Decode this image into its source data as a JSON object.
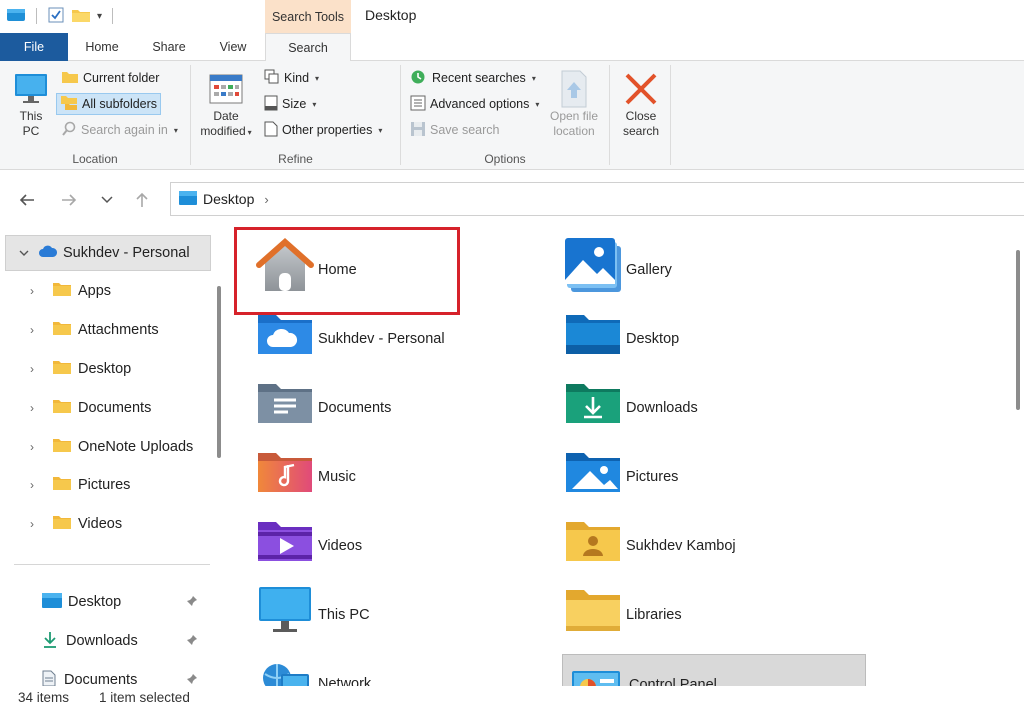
{
  "window": {
    "context_tab_header": "Search Tools",
    "title": "Desktop"
  },
  "ribbon_tabs": {
    "file": "File",
    "home": "Home",
    "share": "Share",
    "view": "View",
    "search": "Search"
  },
  "ribbon": {
    "location": {
      "label": "Location",
      "this_pc_line1": "This",
      "this_pc_line2": "PC",
      "current_folder": "Current folder",
      "all_subfolders": "All subfolders",
      "search_again_in": "Search again in"
    },
    "refine": {
      "label": "Refine",
      "date_modified_line1": "Date",
      "date_modified_line2": "modified",
      "kind": "Kind",
      "size": "Size",
      "other_properties": "Other properties"
    },
    "options": {
      "label": "Options",
      "recent_searches": "Recent searches",
      "advanced_options": "Advanced options",
      "save_search": "Save search",
      "open_file_location_line1": "Open file",
      "open_file_location_line2": "location"
    },
    "close": {
      "line1": "Close",
      "line2": "search"
    }
  },
  "address": {
    "path": "Desktop"
  },
  "navpane": {
    "root": "Sukhdev - Personal",
    "children": [
      "Apps",
      "Attachments",
      "Desktop",
      "Documents",
      "OneNote Uploads",
      "Pictures",
      "Videos"
    ],
    "quick_access": [
      "Desktop",
      "Downloads",
      "Documents"
    ]
  },
  "content": {
    "items": [
      {
        "name": "Home",
        "icon": "home-icon"
      },
      {
        "name": "Gallery",
        "icon": "gallery-icon"
      },
      {
        "name": "Sukhdev - Personal",
        "icon": "onedrive-folder-icon"
      },
      {
        "name": "Desktop",
        "icon": "desktop-folder-icon"
      },
      {
        "name": "Documents",
        "icon": "documents-folder-icon"
      },
      {
        "name": "Downloads",
        "icon": "downloads-folder-icon"
      },
      {
        "name": "Music",
        "icon": "music-folder-icon"
      },
      {
        "name": "Pictures",
        "icon": "pictures-folder-icon"
      },
      {
        "name": "Videos",
        "icon": "videos-folder-icon"
      },
      {
        "name": "Sukhdev Kamboj",
        "icon": "user-folder-icon"
      },
      {
        "name": "This PC",
        "icon": "monitor-icon"
      },
      {
        "name": "Libraries",
        "icon": "libraries-folder-icon"
      },
      {
        "name": "Network",
        "icon": "network-icon"
      },
      {
        "name": "Control Panel",
        "icon": "control-panel-icon"
      }
    ]
  },
  "status": {
    "count": "34 items",
    "selection": "1 item selected"
  },
  "colors": {
    "file_tab": "#1c5b9e",
    "context_tab": "#fbe1c9",
    "highlight": "#d6222a",
    "folder_yellow": "#f6c84c"
  }
}
